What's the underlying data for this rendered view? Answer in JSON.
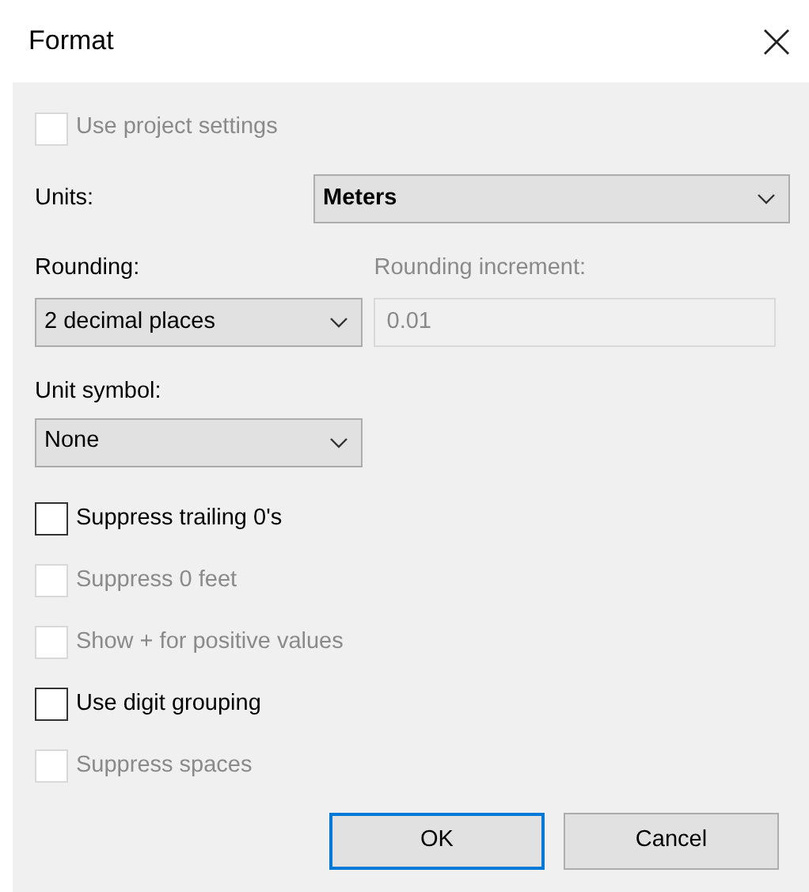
{
  "window": {
    "title": "Format"
  },
  "use_project_settings": {
    "label": "Use project settings",
    "checked": false,
    "disabled": true
  },
  "units": {
    "label": "Units:",
    "value": "Meters"
  },
  "rounding": {
    "label": "Rounding:",
    "value": "2 decimal places"
  },
  "rounding_increment": {
    "label": "Rounding increment:",
    "value": "0.01",
    "disabled": true
  },
  "unit_symbol": {
    "label": "Unit symbol:",
    "value": "None"
  },
  "options": [
    {
      "label": "Suppress trailing 0's",
      "checked": false,
      "disabled": false
    },
    {
      "label": "Suppress 0 feet",
      "checked": false,
      "disabled": true
    },
    {
      "label": "Show + for positive values",
      "checked": false,
      "disabled": true
    },
    {
      "label": "Use digit grouping",
      "checked": false,
      "disabled": false
    },
    {
      "label": "Suppress spaces",
      "checked": false,
      "disabled": true
    }
  ],
  "buttons": [
    {
      "label": "OK",
      "default": true
    },
    {
      "label": "Cancel",
      "default": false
    }
  ]
}
